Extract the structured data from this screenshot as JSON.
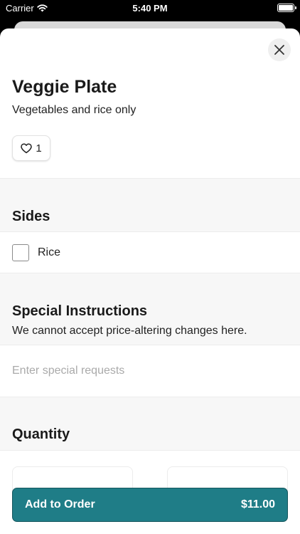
{
  "status_bar": {
    "carrier": "Carrier",
    "time": "5:40 PM"
  },
  "item": {
    "title": "Veggie Plate",
    "description": "Vegetables and rice only",
    "like_count": "1"
  },
  "sides": {
    "title": "Sides",
    "options": [
      {
        "label": "Rice",
        "checked": false
      }
    ]
  },
  "special_instructions": {
    "title": "Special Instructions",
    "subtitle": "We cannot accept price-altering changes here.",
    "placeholder": "Enter special requests",
    "value": ""
  },
  "quantity": {
    "title": "Quantity"
  },
  "add_to_order": {
    "label": "Add to Order",
    "price": "$11.00",
    "color": "#1f7d87"
  }
}
